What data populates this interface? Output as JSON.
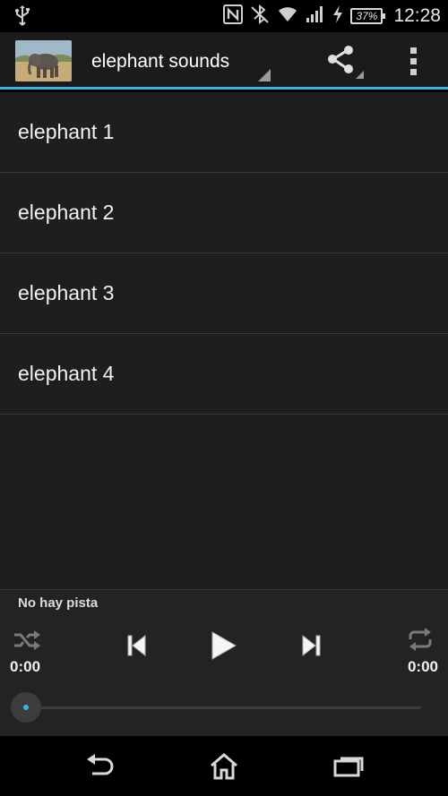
{
  "status_bar": {
    "battery_percent": "37%",
    "time": "12:28"
  },
  "action_bar": {
    "title": "elephant sounds",
    "accent_color": "#33b5e5"
  },
  "list": {
    "items": [
      {
        "label": "elephant 1"
      },
      {
        "label": "elephant 2"
      },
      {
        "label": "elephant 3"
      },
      {
        "label": "elephant 4"
      }
    ]
  },
  "player": {
    "track_name": "No hay pista",
    "elapsed": "0:00",
    "duration": "0:00",
    "progress": 0
  },
  "icons": [
    "usb-icon",
    "nfc-icon",
    "bluetooth-icon",
    "wifi-icon",
    "signal-icon",
    "charging-icon",
    "battery-icon",
    "share-icon",
    "overflow-menu-icon",
    "shuffle-icon",
    "previous-icon",
    "play-icon",
    "next-icon",
    "repeat-icon",
    "back-icon",
    "home-icon",
    "recent-apps-icon"
  ]
}
